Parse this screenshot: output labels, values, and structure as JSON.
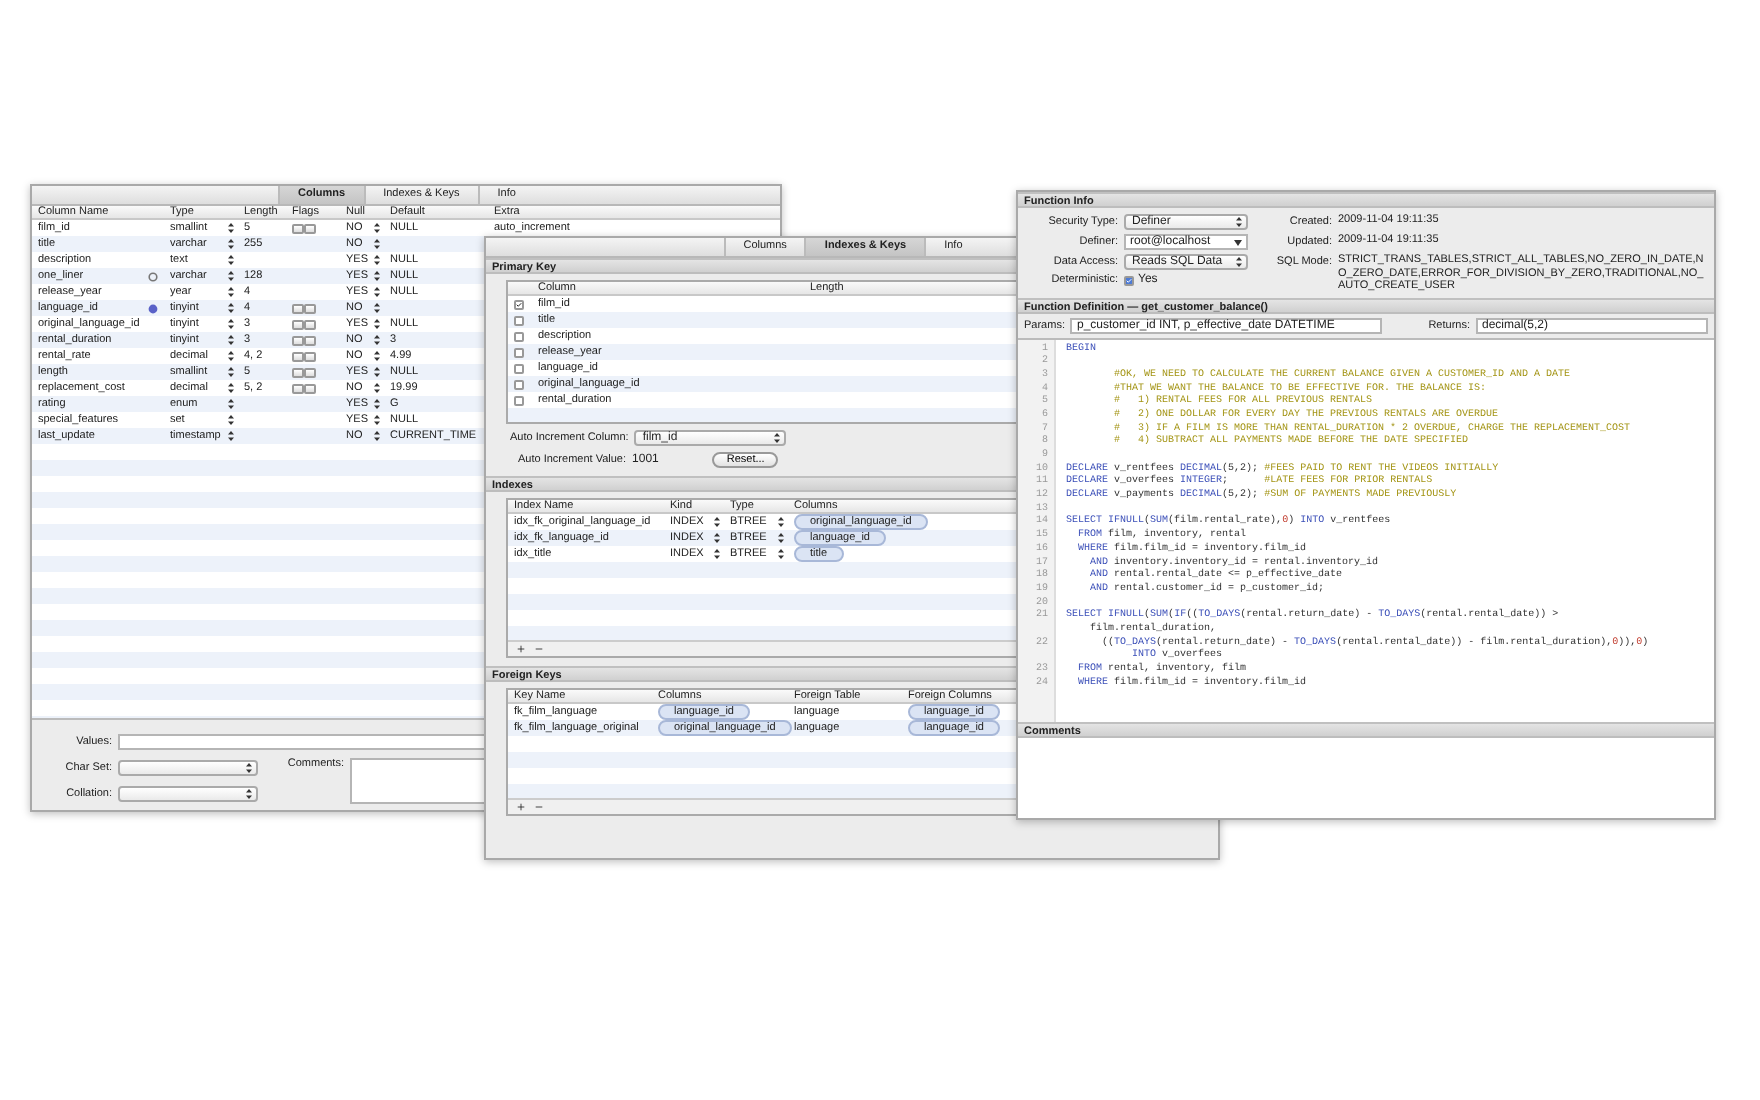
{
  "table_window": {
    "tabs": [
      {
        "label": "Columns",
        "selected": true
      },
      {
        "label": "Indexes & Keys",
        "selected": false
      },
      {
        "label": "Info",
        "selected": false
      }
    ],
    "columns": [
      "Column Name",
      "Type",
      "Length",
      "Flags",
      "Null",
      "Default",
      "Extra"
    ],
    "rows": [
      {
        "name": "film_id",
        "circle": false,
        "type": "smallint",
        "length": "5",
        "flags": true,
        "null": "NO",
        "default": "NULL",
        "extra": "auto_increment"
      },
      {
        "name": "title",
        "circle": false,
        "type": "varchar",
        "length": "255",
        "flags": false,
        "null": "NO"
      },
      {
        "name": "description",
        "circle": false,
        "type": "text",
        "flags": false,
        "null": "YES",
        "default": "NULL"
      },
      {
        "name": "one_liner",
        "circle": true,
        "circle_filled": false,
        "type": "varchar",
        "length": "128",
        "flags": false,
        "null": "YES",
        "default": "NULL"
      },
      {
        "name": "release_year",
        "circle": false,
        "type": "year",
        "length": "4",
        "flags": false,
        "null": "YES",
        "default": "NULL"
      },
      {
        "name": "language_id",
        "circle": true,
        "circle_filled": true,
        "type": "tinyint",
        "length": "4",
        "flags": true,
        "null": "NO"
      },
      {
        "name": "original_language_id",
        "circle": false,
        "type": "tinyint",
        "length": "3",
        "flags": true,
        "null": "YES",
        "default": "NULL"
      },
      {
        "name": "rental_duration",
        "circle": false,
        "type": "tinyint",
        "length": "3",
        "flags": true,
        "null": "NO",
        "default": "3"
      },
      {
        "name": "rental_rate",
        "circle": false,
        "type": "decimal",
        "length": "4, 2",
        "flags": true,
        "null": "NO",
        "default": "4.99"
      },
      {
        "name": "length",
        "circle": false,
        "type": "smallint",
        "length": "5",
        "flags": true,
        "null": "YES",
        "default": "NULL"
      },
      {
        "name": "replacement_cost",
        "circle": false,
        "type": "decimal",
        "length": "5, 2",
        "flags": true,
        "null": "NO",
        "default": "19.99"
      },
      {
        "name": "rating",
        "circle": false,
        "type": "enum",
        "flags": false,
        "null": "YES",
        "default": "G"
      },
      {
        "name": "special_features",
        "circle": false,
        "type": "set",
        "flags": false,
        "null": "YES",
        "default": "NULL"
      },
      {
        "name": "last_update",
        "circle": false,
        "type": "timestamp",
        "flags": false,
        "null": "NO",
        "default": "CURRENT_TIME"
      }
    ],
    "values_label": "Values:",
    "char_set_label": "Char Set:",
    "collation_label": "Collation:",
    "comments_label": "Comments:"
  },
  "keys_window": {
    "tabs": [
      {
        "label": "Columns",
        "selected": false
      },
      {
        "label": "Indexes & Keys",
        "selected": true
      },
      {
        "label": "Info",
        "selected": false
      }
    ],
    "primary_key": {
      "title": "Primary Key",
      "columns": [
        "Column",
        "Length"
      ],
      "rows": [
        {
          "name": "film_id",
          "checked": true
        },
        {
          "name": "title",
          "checked": false
        },
        {
          "name": "description",
          "checked": false
        },
        {
          "name": "release_year",
          "checked": false
        },
        {
          "name": "language_id",
          "checked": false
        },
        {
          "name": "original_language_id",
          "checked": false
        },
        {
          "name": "rental_duration",
          "checked": false
        }
      ],
      "auto_increment_column_label": "Auto Increment Column:",
      "auto_increment_column": "film_id",
      "auto_increment_value_label": "Auto Increment Value:",
      "auto_increment_value": "1001",
      "reset_button": "Reset..."
    },
    "indexes": {
      "title": "Indexes",
      "columns": [
        "Index Name",
        "Kind",
        "Type",
        "Columns"
      ],
      "rows": [
        {
          "name": "idx_fk_original_language_id",
          "kind": "INDEX",
          "type": "BTREE",
          "columns": [
            "original_language_id"
          ]
        },
        {
          "name": "idx_fk_language_id",
          "kind": "INDEX",
          "type": "BTREE",
          "columns": [
            "language_id"
          ]
        },
        {
          "name": "idx_title",
          "kind": "INDEX",
          "type": "BTREE",
          "columns": [
            "title"
          ]
        }
      ]
    },
    "foreign_keys": {
      "title": "Foreign Keys",
      "columns": [
        "Key Name",
        "Columns",
        "Foreign Table",
        "Foreign Columns"
      ],
      "rows": [
        {
          "name": "fk_film_language",
          "columns": [
            "language_id"
          ],
          "foreign_table": "language",
          "foreign_columns": [
            "language_id"
          ]
        },
        {
          "name": "fk_film_language_original",
          "columns": [
            "original_language_id"
          ],
          "foreign_table": "language",
          "foreign_columns": [
            "language_id"
          ]
        }
      ]
    }
  },
  "function_window": {
    "info_title": "Function Info",
    "fields": [
      {
        "label": "Security Type:",
        "kind": "select",
        "value": "Definer"
      },
      {
        "label": "Definer:",
        "kind": "combo",
        "value": "root@localhost"
      },
      {
        "label": "Data Access:",
        "kind": "select",
        "value": "Reads SQL Data"
      },
      {
        "label": "Deterministic:",
        "kind": "checkbox",
        "checked": true,
        "value": "Yes"
      }
    ],
    "details": [
      {
        "label": "Created:",
        "value": "2009-11-04 19:11:35"
      },
      {
        "label": "Updated:",
        "value": "2009-11-04 19:11:35"
      },
      {
        "label": "SQL Mode:",
        "value": "STRICT_TRANS_TABLES,STRICT_ALL_TABLES,NO_ZERO_IN_DATE,NO_ZERO_DATE,ERROR_FOR_DIVISION_BY_ZERO,TRADITIONAL,NO_AUTO_CREATE_USER"
      }
    ],
    "definition_title": "Function Definition — get_customer_balance()",
    "params_label": "Params:",
    "params": "p_customer_id INT, p_effective_date DATETIME",
    "returns_label": "Returns:",
    "returns": "decimal(5,2)",
    "code": [
      {
        "n": "1",
        "tokens": [
          {
            "kind": "keyword",
            "text": "BEGIN"
          }
        ]
      },
      {
        "n": "2"
      },
      {
        "n": "3",
        "tokens": [
          {
            "kind": "comment",
            "text": "        #OK, WE NEED TO CALCULATE THE CURRENT BALANCE GIVEN A CUSTOMER_ID AND A DATE"
          }
        ]
      },
      {
        "n": "4",
        "tokens": [
          {
            "kind": "comment",
            "text": "        #THAT WE WANT THE BALANCE TO BE EFFECTIVE FOR. THE BALANCE IS:"
          }
        ]
      },
      {
        "n": "5",
        "tokens": [
          {
            "kind": "comment",
            "text": "        #   1) RENTAL FEES FOR ALL PREVIOUS RENTALS"
          }
        ]
      },
      {
        "n": "6",
        "tokens": [
          {
            "kind": "comment",
            "text": "        #   2) ONE DOLLAR FOR EVERY DAY THE PREVIOUS RENTALS ARE OVERDUE"
          }
        ]
      },
      {
        "n": "7",
        "tokens": [
          {
            "kind": "comment",
            "text": "        #   3) IF A FILM IS MORE THAN RENTAL_DURATION * 2 OVERDUE, CHARGE THE REPLACEMENT_COST"
          }
        ]
      },
      {
        "n": "8",
        "tokens": [
          {
            "kind": "comment",
            "text": "        #   4) SUBTRACT ALL PAYMENTS MADE BEFORE THE DATE SPECIFIED"
          }
        ]
      },
      {
        "n": "9"
      },
      {
        "n": "10",
        "tokens": [
          {
            "kind": "keyword",
            "text": "DECLARE "
          },
          {
            "kind": "plain",
            "text": "v_rentfees "
          },
          {
            "kind": "keyword",
            "text": "DECIMAL"
          },
          {
            "kind": "plain",
            "text": "(5,2); "
          },
          {
            "kind": "comment",
            "text": "#FEES PAID TO RENT THE VIDEOS INITIALLY"
          }
        ]
      },
      {
        "n": "11",
        "tokens": [
          {
            "kind": "keyword",
            "text": "DECLARE "
          },
          {
            "kind": "plain",
            "text": "v_overfees "
          },
          {
            "kind": "keyword",
            "text": "INTEGER"
          },
          {
            "kind": "plain",
            "text": ";      "
          },
          {
            "kind": "comment",
            "text": "#LATE FEES FOR PRIOR RENTALS"
          }
        ]
      },
      {
        "n": "12",
        "tokens": [
          {
            "kind": "keyword",
            "text": "DECLARE "
          },
          {
            "kind": "plain",
            "text": "v_payments "
          },
          {
            "kind": "keyword",
            "text": "DECIMAL"
          },
          {
            "kind": "plain",
            "text": "(5,2); "
          },
          {
            "kind": "comment",
            "text": "#SUM OF PAYMENTS MADE PREVIOUSLY"
          }
        ]
      },
      {
        "n": "13"
      },
      {
        "n": "14",
        "tokens": [
          {
            "kind": "keyword",
            "text": "SELECT IFNULL"
          },
          {
            "kind": "plain",
            "text": "("
          },
          {
            "kind": "keyword",
            "text": "SUM"
          },
          {
            "kind": "plain",
            "text": "(film.rental_rate),"
          },
          {
            "kind": "number",
            "text": "0"
          },
          {
            "kind": "plain",
            "text": ") "
          },
          {
            "kind": "keyword",
            "text": "INTO "
          },
          {
            "kind": "plain",
            "text": "v_rentfees"
          }
        ]
      },
      {
        "n": "15",
        "tokens": [
          {
            "kind": "keyword",
            "text": "  FROM "
          },
          {
            "kind": "plain",
            "text": "film, inventory, rental"
          }
        ]
      },
      {
        "n": "16",
        "tokens": [
          {
            "kind": "keyword",
            "text": "  WHERE "
          },
          {
            "kind": "plain",
            "text": "film.film_id = inventory.film_id"
          }
        ]
      },
      {
        "n": "17",
        "tokens": [
          {
            "kind": "keyword",
            "text": "    AND "
          },
          {
            "kind": "plain",
            "text": "inventory.inventory_id = rental.inventory_id"
          }
        ]
      },
      {
        "n": "18",
        "tokens": [
          {
            "kind": "keyword",
            "text": "    AND "
          },
          {
            "kind": "plain",
            "text": "rental.rental_date <= p_effective_date"
          }
        ]
      },
      {
        "n": "19",
        "tokens": [
          {
            "kind": "keyword",
            "text": "    AND "
          },
          {
            "kind": "plain",
            "text": "rental.customer_id = p_customer_id;"
          }
        ]
      },
      {
        "n": "20"
      },
      {
        "n": "21",
        "tokens": [
          {
            "kind": "keyword",
            "text": "SELECT IFNULL"
          },
          {
            "kind": "plain",
            "text": "("
          },
          {
            "kind": "keyword",
            "text": "SUM"
          },
          {
            "kind": "plain",
            "text": "("
          },
          {
            "kind": "keyword",
            "text": "IF"
          },
          {
            "kind": "plain",
            "text": "(("
          },
          {
            "kind": "keyword",
            "text": "TO_DAYS"
          },
          {
            "kind": "plain",
            "text": "(rental.return_date) - "
          },
          {
            "kind": "keyword",
            "text": "TO_DAYS"
          },
          {
            "kind": "plain",
            "text": "(rental.rental_date)) >"
          }
        ]
      },
      {
        "tokens": [
          {
            "kind": "plain",
            "text": "    film.rental_duration,"
          }
        ]
      },
      {
        "n": "22",
        "tokens": [
          {
            "kind": "plain",
            "text": "      (("
          },
          {
            "kind": "keyword",
            "text": "TO_DAYS"
          },
          {
            "kind": "plain",
            "text": "(rental.return_date) - "
          },
          {
            "kind": "keyword",
            "text": "TO_DAYS"
          },
          {
            "kind": "plain",
            "text": "(rental.rental_date)) - film.rental_duration),"
          },
          {
            "kind": "number",
            "text": "0"
          },
          {
            "kind": "plain",
            "text": ")),"
          },
          {
            "kind": "number",
            "text": "0"
          },
          {
            "kind": "plain",
            "text": ")"
          }
        ]
      },
      {
        "tokens": [
          {
            "kind": "keyword",
            "text": "           INTO "
          },
          {
            "kind": "plain",
            "text": "v_overfees"
          }
        ]
      },
      {
        "n": "23",
        "tokens": [
          {
            "kind": "keyword",
            "text": "  FROM "
          },
          {
            "kind": "plain",
            "text": "rental, inventory, film"
          }
        ]
      },
      {
        "n": "24",
        "tokens": [
          {
            "kind": "keyword",
            "text": "  WHERE "
          },
          {
            "kind": "plain",
            "text": "film.film_id = inventory.film_id"
          }
        ]
      }
    ],
    "comments_title": "Comments"
  }
}
